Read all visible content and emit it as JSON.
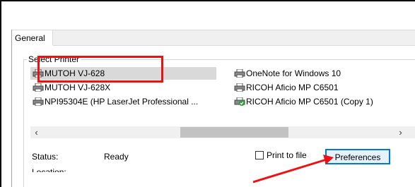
{
  "tabs": [
    {
      "label": "General"
    }
  ],
  "group_label": "Select Printer",
  "printers": [
    {
      "name": "MUTOH VJ-628",
      "icon": "printer-icon",
      "selected": true
    },
    {
      "name": "MUTOH VJ-628X",
      "icon": "printer-icon",
      "selected": false
    },
    {
      "name": "NPI95304E (HP LaserJet Professional ...",
      "icon": "printer-icon",
      "selected": false
    },
    {
      "name": "OneNote for Windows 10",
      "icon": "printer-icon",
      "selected": false
    },
    {
      "name": "RICOH Aficio MP C6501",
      "icon": "printer-icon",
      "selected": false
    },
    {
      "name": "RICOH Aficio MP C6501 (Copy 1)",
      "icon": "printer-default-icon",
      "selected": false
    }
  ],
  "scrollbar": {
    "left_arrow": "‹",
    "right_arrow": "›"
  },
  "status": {
    "label": "Status:",
    "value": "Ready"
  },
  "partial_label": "Location:",
  "print_to_file": {
    "label": "Print to file",
    "checked": false
  },
  "preferences_button": {
    "label": "Preferences"
  },
  "annotation_colors": {
    "highlight": "#ee1111",
    "arrow": "#ee1111"
  }
}
